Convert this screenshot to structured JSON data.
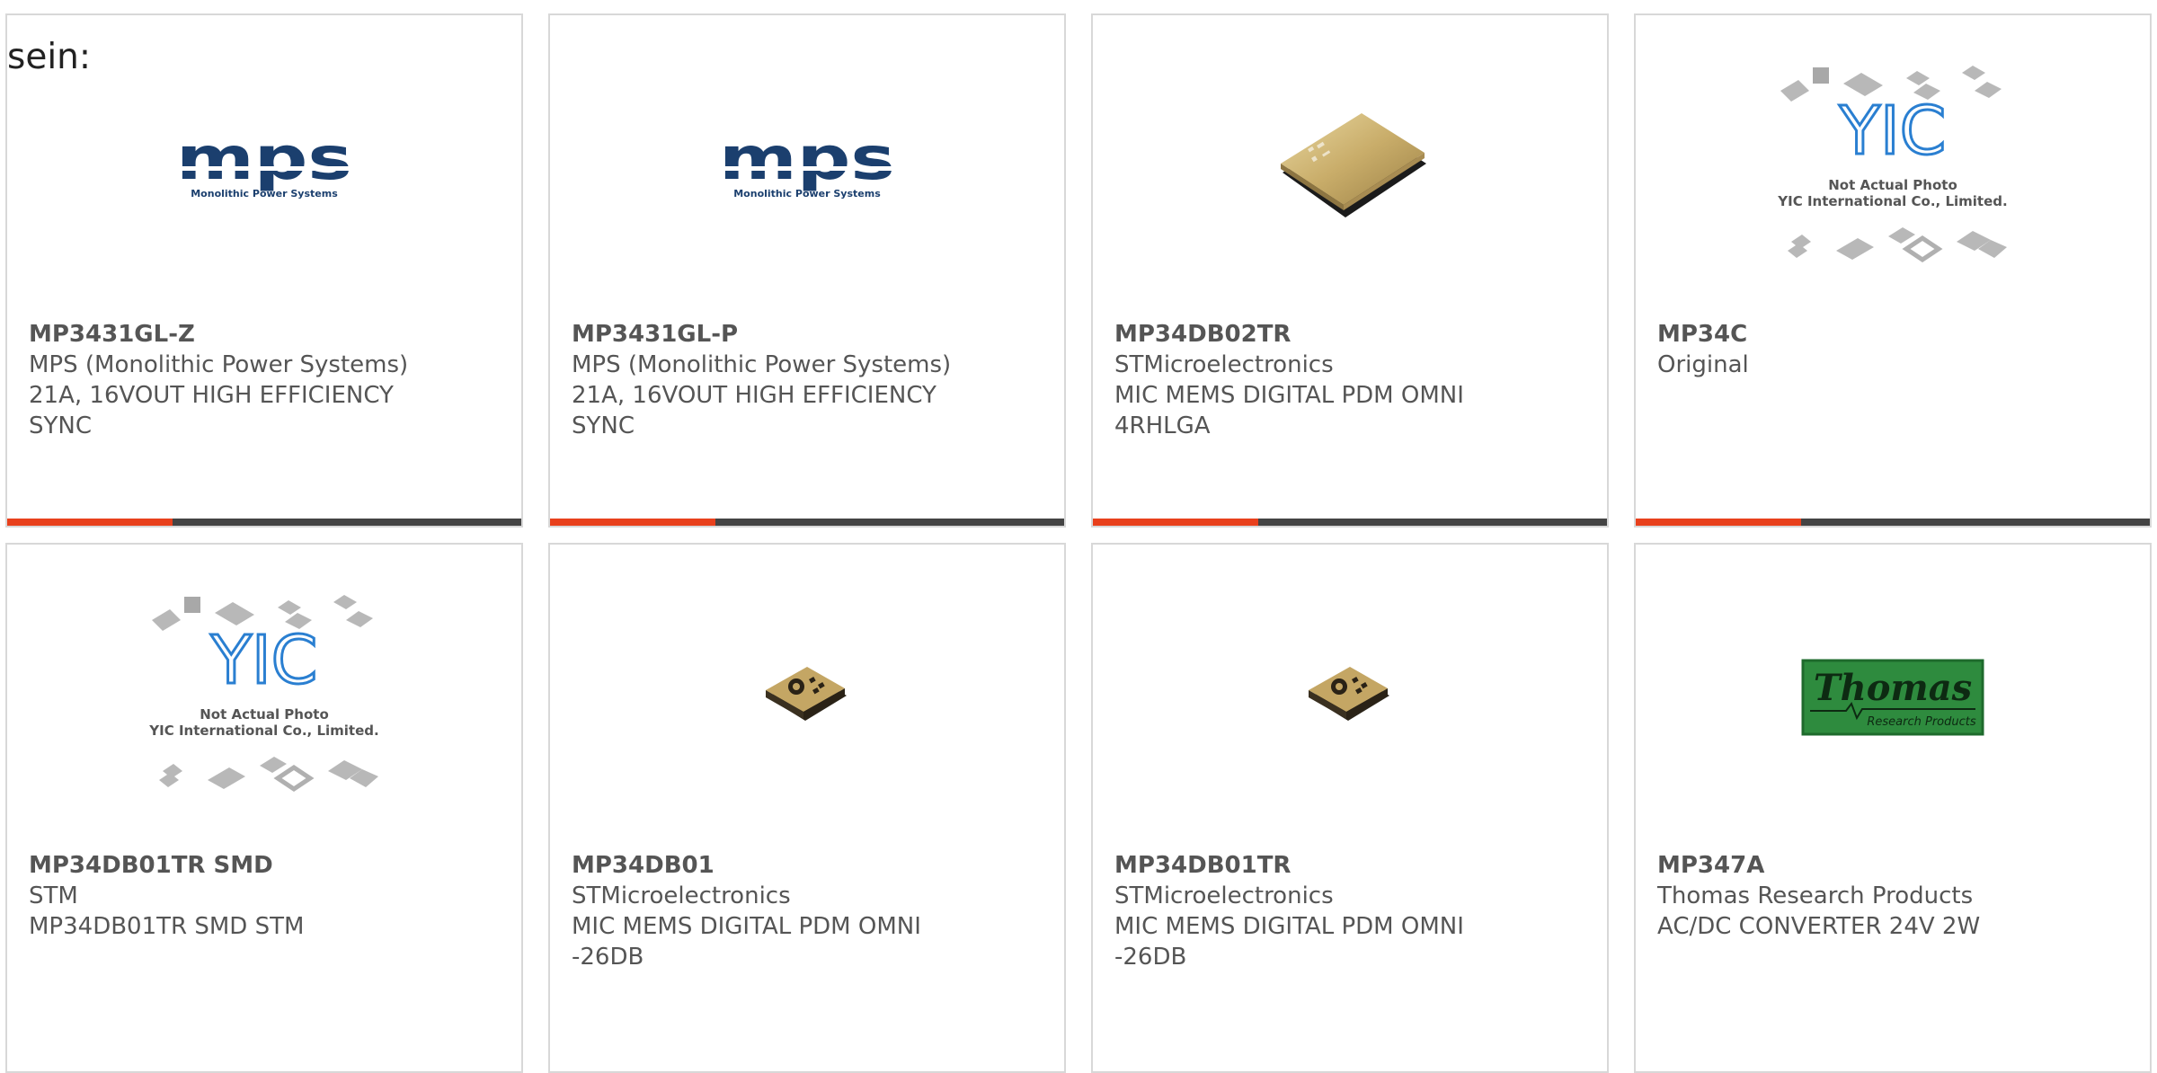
{
  "page": {
    "lead_text": "sein:"
  },
  "colors": {
    "accent": "#e8401c",
    "bar": "#444444",
    "border": "#d8d8d8",
    "text": "#555555",
    "mps_blue": "#1b3f6e",
    "thomas_green": "#2e8b3e"
  },
  "products": [
    {
      "part": "MP3431GL-Z",
      "manufacturer": "MPS (Monolithic Power Systems)",
      "description": "21A, 16VOUT HIGH EFFICIENCY SYNC",
      "image": "mps-logo",
      "logo_text": "Monolithic Power Systems"
    },
    {
      "part": "MP3431GL-P",
      "manufacturer": "MPS (Monolithic Power Systems)",
      "description": "21A, 16VOUT HIGH EFFICIENCY SYNC",
      "image": "mps-logo",
      "logo_text": "Monolithic Power Systems"
    },
    {
      "part": "MP34DB02TR",
      "manufacturer": "STMicroelectronics",
      "description": "MIC MEMS DIGITAL PDM OMNI 4RHLGA",
      "image": "gold-lga-package"
    },
    {
      "part": "MP34C",
      "manufacturer": "Original",
      "description": "",
      "image": "yic-placeholder",
      "placeholder_line1": "Not Actual Photo",
      "placeholder_line2": "YIC International Co., Limited."
    },
    {
      "part": "MP34DB01TR SMD",
      "manufacturer": "STM",
      "description": "MP34DB01TR SMD STM",
      "image": "yic-placeholder",
      "placeholder_line1": "Not Actual Photo",
      "placeholder_line2": "YIC International Co., Limited."
    },
    {
      "part": "MP34DB01",
      "manufacturer": "STMicroelectronics",
      "description": "MIC MEMS DIGITAL PDM OMNI -26DB",
      "image": "mems-mic-package"
    },
    {
      "part": "MP34DB01TR",
      "manufacturer": "STMicroelectronics",
      "description": "MIC MEMS DIGITAL PDM OMNI -26DB",
      "image": "mems-mic-package"
    },
    {
      "part": "MP347A",
      "manufacturer": "Thomas Research Products",
      "description": "AC/DC CONVERTER 24V 2W",
      "image": "thomas-logo",
      "logo_text": "Thomas",
      "logo_subtext": "Research Products"
    }
  ]
}
